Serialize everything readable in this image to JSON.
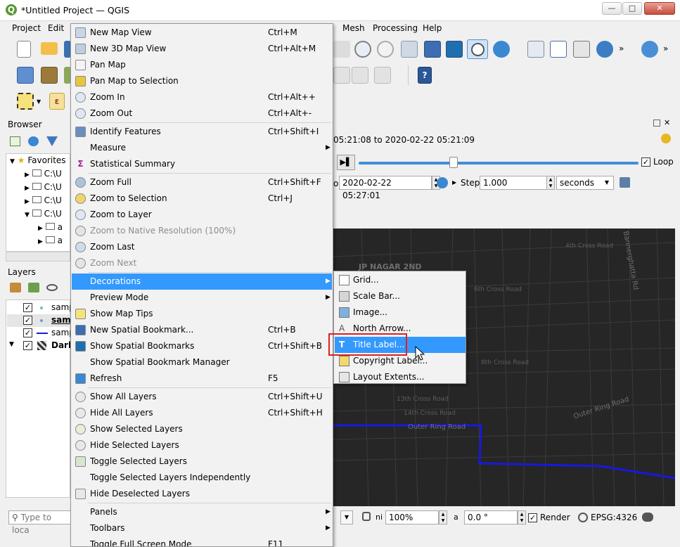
{
  "window": {
    "title": "*Untitled Project — QGIS",
    "min": "—",
    "max": "□",
    "close": "✕"
  },
  "menubar": {
    "items": [
      "Project",
      "Edit",
      "Mesh",
      "Processing",
      "Help"
    ]
  },
  "browser": {
    "title": "Browser",
    "favorites": "Favorites",
    "items": [
      "C:\\U",
      "C:\\U",
      "C:\\U",
      "C:\\U",
      "a",
      "a"
    ]
  },
  "layers": {
    "title": "Layers",
    "items": [
      {
        "label": "samp",
        "checked": true,
        "bold": false
      },
      {
        "label": "samp",
        "checked": true,
        "bold": true
      },
      {
        "label": "samp",
        "checked": true,
        "bold": false
      },
      {
        "label": "Dark",
        "checked": true,
        "bold": true
      }
    ]
  },
  "temporal": {
    "range_text": "05:21:08 to 2020-02-22 05:21:09",
    "end_value": "2020-02-22 05:27:01",
    "step_label": "Step",
    "step_value": "1.000",
    "unit": "seconds",
    "loop_label": "Loop",
    "loop_checked": true,
    "slider_fraction": 0.34,
    "to_label": "o"
  },
  "menu": {
    "items": [
      {
        "label": "New Map View",
        "shortcut": "Ctrl+M",
        "icon": "map-view-icon"
      },
      {
        "label": "New 3D Map View",
        "shortcut": "Ctrl+Alt+M",
        "icon": "3d-map-icon"
      },
      {
        "label": "Pan Map",
        "shortcut": "",
        "icon": "pan-hand-icon"
      },
      {
        "label": "Pan Map to Selection",
        "shortcut": "",
        "icon": "pan-selection-icon"
      },
      {
        "label": "Zoom In",
        "shortcut": "Ctrl+Alt++",
        "icon": "zoom-in-icon"
      },
      {
        "label": "Zoom Out",
        "shortcut": "Ctrl+Alt+-",
        "icon": "zoom-out-icon"
      },
      {
        "label": "Identify Features",
        "shortcut": "Ctrl+Shift+I",
        "icon": "identify-icon"
      },
      {
        "label": "Measure",
        "shortcut": "",
        "icon": "",
        "submenu": true
      },
      {
        "label": "Statistical Summary",
        "shortcut": "",
        "icon": "sigma-icon"
      },
      {
        "label": "Zoom Full",
        "shortcut": "Ctrl+Shift+F",
        "icon": "zoom-full-icon"
      },
      {
        "label": "Zoom to Selection",
        "shortcut": "Ctrl+J",
        "icon": "zoom-selection-icon"
      },
      {
        "label": "Zoom to Layer",
        "shortcut": "",
        "icon": "zoom-layer-icon"
      },
      {
        "label": "Zoom to Native Resolution (100%)",
        "shortcut": "",
        "icon": "zoom-native-icon",
        "disabled": true
      },
      {
        "label": "Zoom Last",
        "shortcut": "",
        "icon": "zoom-last-icon"
      },
      {
        "label": "Zoom Next",
        "shortcut": "",
        "icon": "zoom-next-icon",
        "disabled": true
      },
      {
        "label": "Decorations",
        "shortcut": "",
        "icon": "",
        "submenu": true,
        "highlight": true
      },
      {
        "label": "Preview Mode",
        "shortcut": "",
        "icon": "",
        "submenu": true
      },
      {
        "label": "Show Map Tips",
        "shortcut": "",
        "icon": "map-tips-icon"
      },
      {
        "label": "New Spatial Bookmark...",
        "shortcut": "Ctrl+B",
        "icon": "new-bookmark-icon"
      },
      {
        "label": "Show Spatial Bookmarks",
        "shortcut": "Ctrl+Shift+B",
        "icon": "bookmarks-icon"
      },
      {
        "label": "Show Spatial Bookmark Manager",
        "shortcut": "",
        "icon": ""
      },
      {
        "label": "Refresh",
        "shortcut": "F5",
        "icon": "refresh-icon"
      },
      {
        "label": "Show All Layers",
        "shortcut": "Ctrl+Shift+U",
        "icon": "eye-icon"
      },
      {
        "label": "Hide All Layers",
        "shortcut": "Ctrl+Shift+H",
        "icon": "eye-closed-icon"
      },
      {
        "label": "Show Selected Layers",
        "shortcut": "",
        "icon": "eye-selected-icon"
      },
      {
        "label": "Hide Selected Layers",
        "shortcut": "",
        "icon": "eye-hide-selected-icon"
      },
      {
        "label": "Toggle Selected Layers",
        "shortcut": "",
        "icon": "toggle-layers-icon"
      },
      {
        "label": "Toggle Selected Layers Independently",
        "shortcut": "",
        "icon": ""
      },
      {
        "label": "Hide Deselected Layers",
        "shortcut": "",
        "icon": "hide-deselected-icon"
      },
      {
        "label": "Panels",
        "shortcut": "",
        "icon": "",
        "submenu": true
      },
      {
        "label": "Toolbars",
        "shortcut": "",
        "icon": "",
        "submenu": true
      },
      {
        "label": "Toggle Full Screen Mode",
        "shortcut": "F11",
        "icon": ""
      }
    ]
  },
  "submenu": {
    "items": [
      {
        "label": "Grid...",
        "icon": "grid-icon"
      },
      {
        "label": "Scale Bar...",
        "icon": "scale-bar-icon"
      },
      {
        "label": "Image...",
        "icon": "image-icon"
      },
      {
        "label": "North Arrow...",
        "icon": "north-arrow-icon"
      },
      {
        "label": "Title Label...",
        "icon": "title-label-icon",
        "highlight": true
      },
      {
        "label": "Copyright Label...",
        "icon": "copyright-icon"
      },
      {
        "label": "Layout Extents...",
        "icon": "layout-extents-icon"
      }
    ]
  },
  "map": {
    "labels": [
      "JP NAGAR 2ND",
      "Outer Ring Road",
      "Outer Ring Road",
      "Bannerghatta Rd",
      "6th Cross Road",
      "8th Cross Road",
      "13th Cross Road",
      "14th Cross Road",
      "4th Cross Road"
    ]
  },
  "statusbar": {
    "search_placeholder": "Type to loca",
    "scale_value": "100%",
    "rotation_value": "0.0 °",
    "render_label": "Render",
    "render_checked": true,
    "crs": "EPSG:4326",
    "mag_prefix": "ni",
    "rot_prefix": "a"
  }
}
